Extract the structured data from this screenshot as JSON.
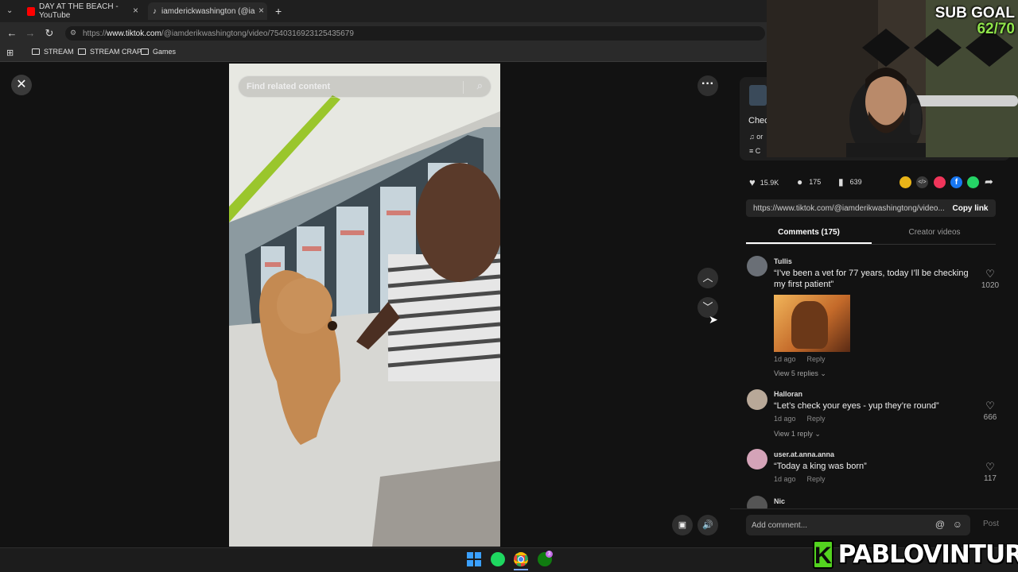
{
  "browser": {
    "tabs": [
      {
        "title": "DAY AT THE BEACH - YouTube",
        "favicon": "youtube-icon",
        "color": "#ff0000"
      },
      {
        "title": "iamderickwashington (@ia",
        "favicon": "tiktok-icon",
        "color": "#ffffff"
      }
    ],
    "url_prefix": "https://",
    "url_host": "www.tiktok.com",
    "url_path": "/@iamderikwashingtong/video/7540316923125435679",
    "bookmarks": [
      "STREAM",
      "STREAM CRAP",
      "Games"
    ]
  },
  "video": {
    "search_placeholder": "Find related content"
  },
  "info": {
    "caption_start": "Chec",
    "music_start": "or",
    "collection_start": "C"
  },
  "stats": {
    "likes": "15.9K",
    "comments": "175",
    "saves": "639"
  },
  "share_colors": [
    "#e9b418",
    "#3a3a3a",
    "#f0355a",
    "#1877f2",
    "#25d366"
  ],
  "link": {
    "url": "https://www.tiktok.com/@iamderikwashingtong/video...",
    "copy_label": "Copy link"
  },
  "tabs": {
    "comments": "Comments (175)",
    "creator": "Creator videos"
  },
  "comments": [
    {
      "user": "Tullis",
      "text": "“I’ve been a vet for 77 years, today I’ll be checking my first patient”",
      "time": "1d ago",
      "reply": "Reply",
      "likes": "1020",
      "view_replies": "View 5 replies"
    },
    {
      "user": "Halloran",
      "text": "“Let’s check your eyes - yup they’re round”",
      "time": "1d ago",
      "reply": "Reply",
      "likes": "666",
      "view_replies": "View 1 reply"
    },
    {
      "user": "user.at.anna.anna",
      "text": "“Today a king was born”",
      "time": "1d ago",
      "reply": "Reply",
      "likes": "117"
    },
    {
      "user": "Nic"
    }
  ],
  "comment_box": {
    "placeholder": "Add comment...",
    "post": "Post"
  },
  "overlay": {
    "sub_goal_label": "SUB GOAL",
    "sub_goal_count": "62/70",
    "brand_letter": "K",
    "brand_name": "PABLOVINTURA",
    "brand_color": "#53d31f"
  },
  "taskbar": {
    "xbox_badge": "3"
  }
}
